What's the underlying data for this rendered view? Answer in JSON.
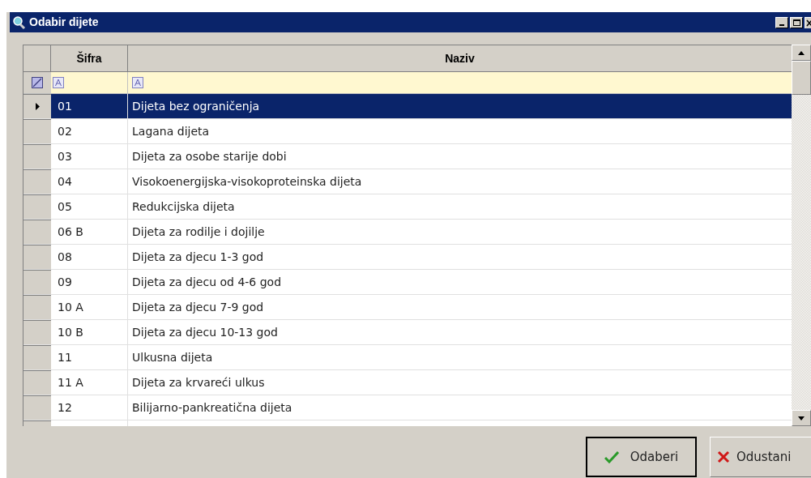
{
  "window": {
    "title": "Odabir dijete"
  },
  "table": {
    "columns": [
      "Šifra",
      "Naziv"
    ],
    "rows": [
      {
        "code": "01",
        "name": "Dijeta bez  ograničenja",
        "selected": true
      },
      {
        "code": "02",
        "name": "Lagana dijeta",
        "selected": false
      },
      {
        "code": "03",
        "name": "Dijeta za osobe starije dobi",
        "selected": false
      },
      {
        "code": "04",
        "name": "Visokoenergijska-visokoproteinska dijeta",
        "selected": false
      },
      {
        "code": "05",
        "name": "Redukcijska dijeta",
        "selected": false
      },
      {
        "code": "06 B",
        "name": "Dijeta za rodilje i dojilje",
        "selected": false
      },
      {
        "code": "08",
        "name": "Dijeta za djecu 1-3 god",
        "selected": false
      },
      {
        "code": "09",
        "name": "Dijeta za djecu od 4-6 god",
        "selected": false
      },
      {
        "code": "10 A",
        "name": "Dijeta za djecu 7-9 god",
        "selected": false
      },
      {
        "code": "10 B",
        "name": "Dijeta za djecu 10-13 god",
        "selected": false
      },
      {
        "code": "11",
        "name": "Ulkusna dijeta",
        "selected": false
      },
      {
        "code": "11 A",
        "name": "Dijeta za krvareći ulkus",
        "selected": false
      },
      {
        "code": "12",
        "name": "Bilijarno-pankreatična dijeta",
        "selected": false
      }
    ]
  },
  "buttons": [
    {
      "label": "Odaberi",
      "kind": "ok"
    },
    {
      "label": "Odustani",
      "kind": "cancel"
    }
  ]
}
